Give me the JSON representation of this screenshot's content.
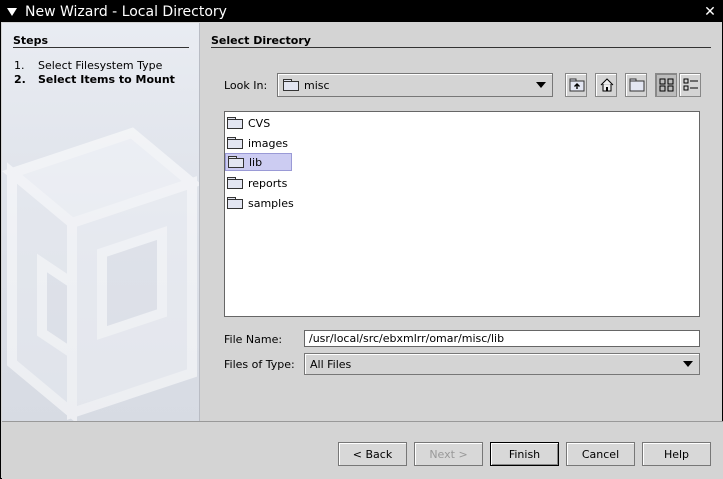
{
  "window": {
    "title": "New Wizard - Local Directory"
  },
  "steps": {
    "heading": "Steps",
    "items": [
      {
        "num": "1.",
        "label": "Select Filesystem Type",
        "current": false
      },
      {
        "num": "2.",
        "label": "Select Items to Mount",
        "current": true
      }
    ]
  },
  "panel": {
    "title": "Select Directory"
  },
  "look_in": {
    "label": "Look In:",
    "value": "misc"
  },
  "toolbar": {
    "icons": [
      "up-folder-icon",
      "home-icon",
      "new-folder-icon",
      "list-view-icon",
      "details-view-icon"
    ],
    "active_view": "list-view"
  },
  "files": [
    {
      "name": "CVS",
      "icon": "folder-icon",
      "selected": false
    },
    {
      "name": "images",
      "icon": "folder-icon",
      "selected": false
    },
    {
      "name": "lib",
      "icon": "folder-icon",
      "selected": true
    },
    {
      "name": "reports",
      "icon": "folder-icon",
      "selected": false
    },
    {
      "name": "samples",
      "icon": "folder-icon",
      "selected": false
    }
  ],
  "file_name": {
    "label": "File Name:",
    "value": "/usr/local/src/ebxmlrr/omar/misc/lib"
  },
  "file_type": {
    "label": "Files of Type:",
    "value": "All Files"
  },
  "buttons": {
    "back": "< Back",
    "next": "Next >",
    "finish": "Finish",
    "cancel": "Cancel",
    "help": "Help"
  }
}
